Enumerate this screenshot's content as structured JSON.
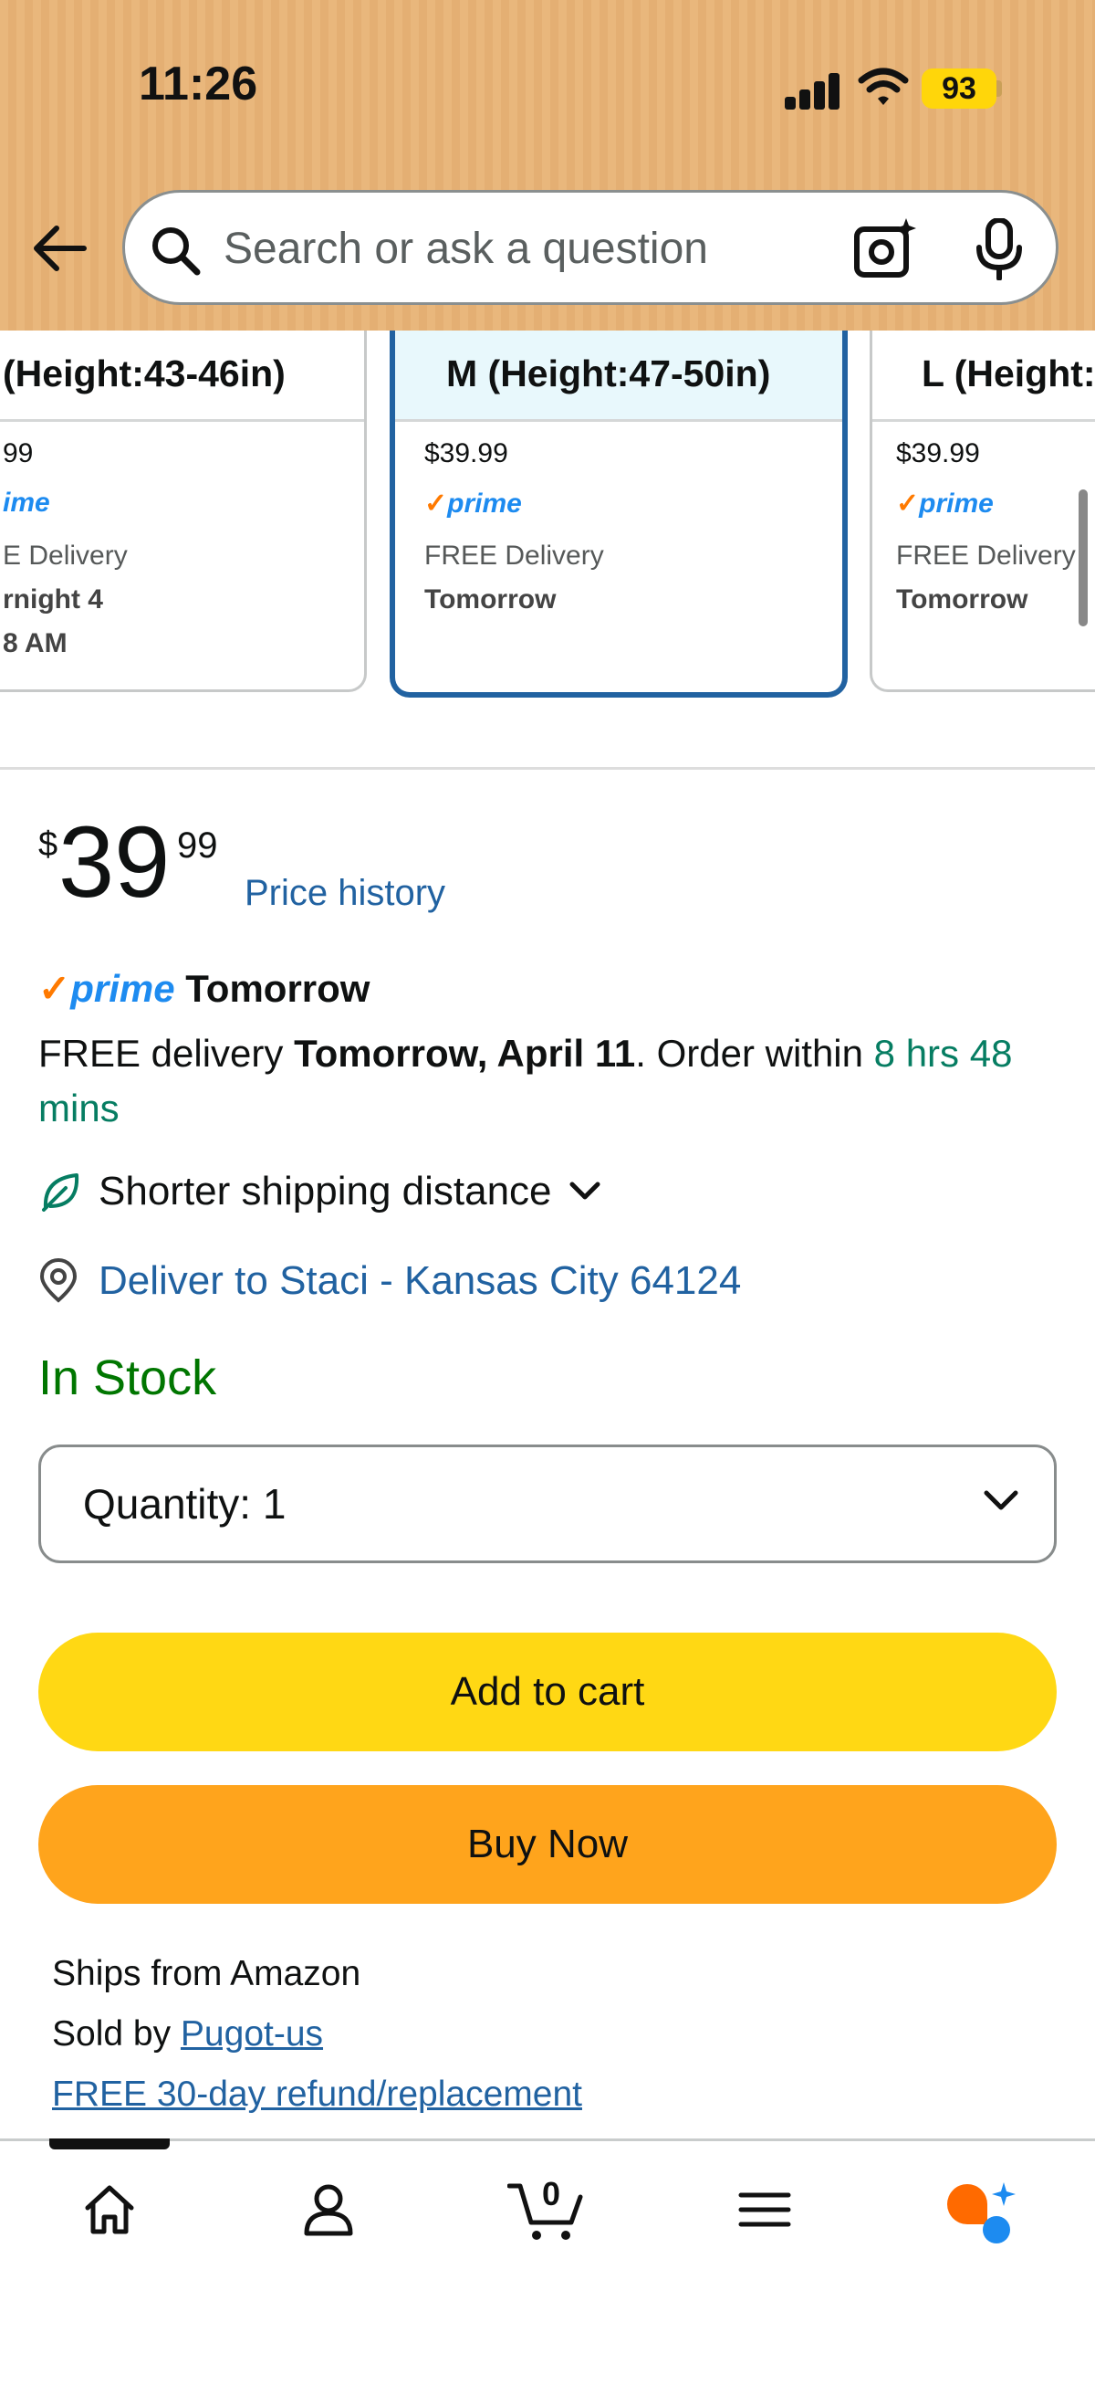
{
  "status_bar": {
    "time": "11:26",
    "battery": "93"
  },
  "search": {
    "placeholder": "Search or ask a question"
  },
  "size_cards": [
    {
      "label": "(Height:43-46in)",
      "price": "99",
      "prime": "ime",
      "free": "E Delivery",
      "when1": "rnight 4",
      "when2": "8 AM"
    },
    {
      "label": "M (Height:47-50in)",
      "price": "$39.99",
      "prime": "prime",
      "free": "FREE Delivery",
      "when1": "Tomorrow"
    },
    {
      "label": "L (Height:",
      "price": "$39.99",
      "prime": "prime",
      "free": "FREE Delivery",
      "when1": "Tomorrow"
    }
  ],
  "price": {
    "currency": "$",
    "whole": "39",
    "fraction": "99",
    "history_label": "Price history"
  },
  "prime_line": {
    "check": "✓",
    "prime": "prime",
    "label": "Tomorrow"
  },
  "delivery": {
    "prefix": "FREE delivery ",
    "date": "Tomorrow, April 11",
    "middle": ". Order within ",
    "countdown": "8 hrs 48 mins"
  },
  "shipping_note": "Shorter shipping distance",
  "deliver_to": "Deliver to Staci - Kansas City 64124",
  "stock": "In Stock",
  "quantity": {
    "label": "Quantity:",
    "value": "1"
  },
  "buttons": {
    "add_to_cart": "Add to cart",
    "buy_now": "Buy Now"
  },
  "seller": {
    "ships_from": "Ships from Amazon",
    "sold_by_label": "Sold by ",
    "sold_by": "Pugot-us",
    "refund": "FREE 30-day refund/replacement"
  },
  "nav": {
    "cart_count": "0",
    "icons": [
      "home-icon",
      "account-icon",
      "cart-icon",
      "menu-icon",
      "rufus-icon"
    ]
  },
  "colors": {
    "header": "#e9b77c",
    "link": "#2162a1",
    "green": "#067d62",
    "in_stock": "#007600",
    "add_to_cart": "#ffd814",
    "buy_now": "#ffa41c",
    "selected_border": "#2162a1"
  }
}
